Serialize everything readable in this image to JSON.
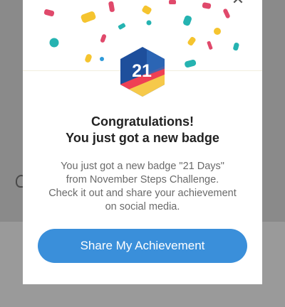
{
  "background": {
    "color": "#8a8a8a"
  },
  "modal": {
    "close_icon": "close-icon",
    "badge": {
      "number": "21",
      "colors": [
        "#1e4f9c",
        "#ef4054",
        "#f6c94a",
        "#2e68b8"
      ]
    },
    "title_line1": "Congratulations!",
    "title_line2": "You just got a new badge",
    "description_lines": [
      "You just got a new badge \"21 Days\"",
      "from November Steps Challenge.",
      "Check it out and share your achievement",
      "on social media."
    ],
    "share_button": {
      "label": "Share My Achievement",
      "color": "#3a8fda"
    },
    "confetti_colors": [
      "#e0496b",
      "#f5c42f",
      "#25b3b1",
      "#2e9ad9"
    ]
  }
}
